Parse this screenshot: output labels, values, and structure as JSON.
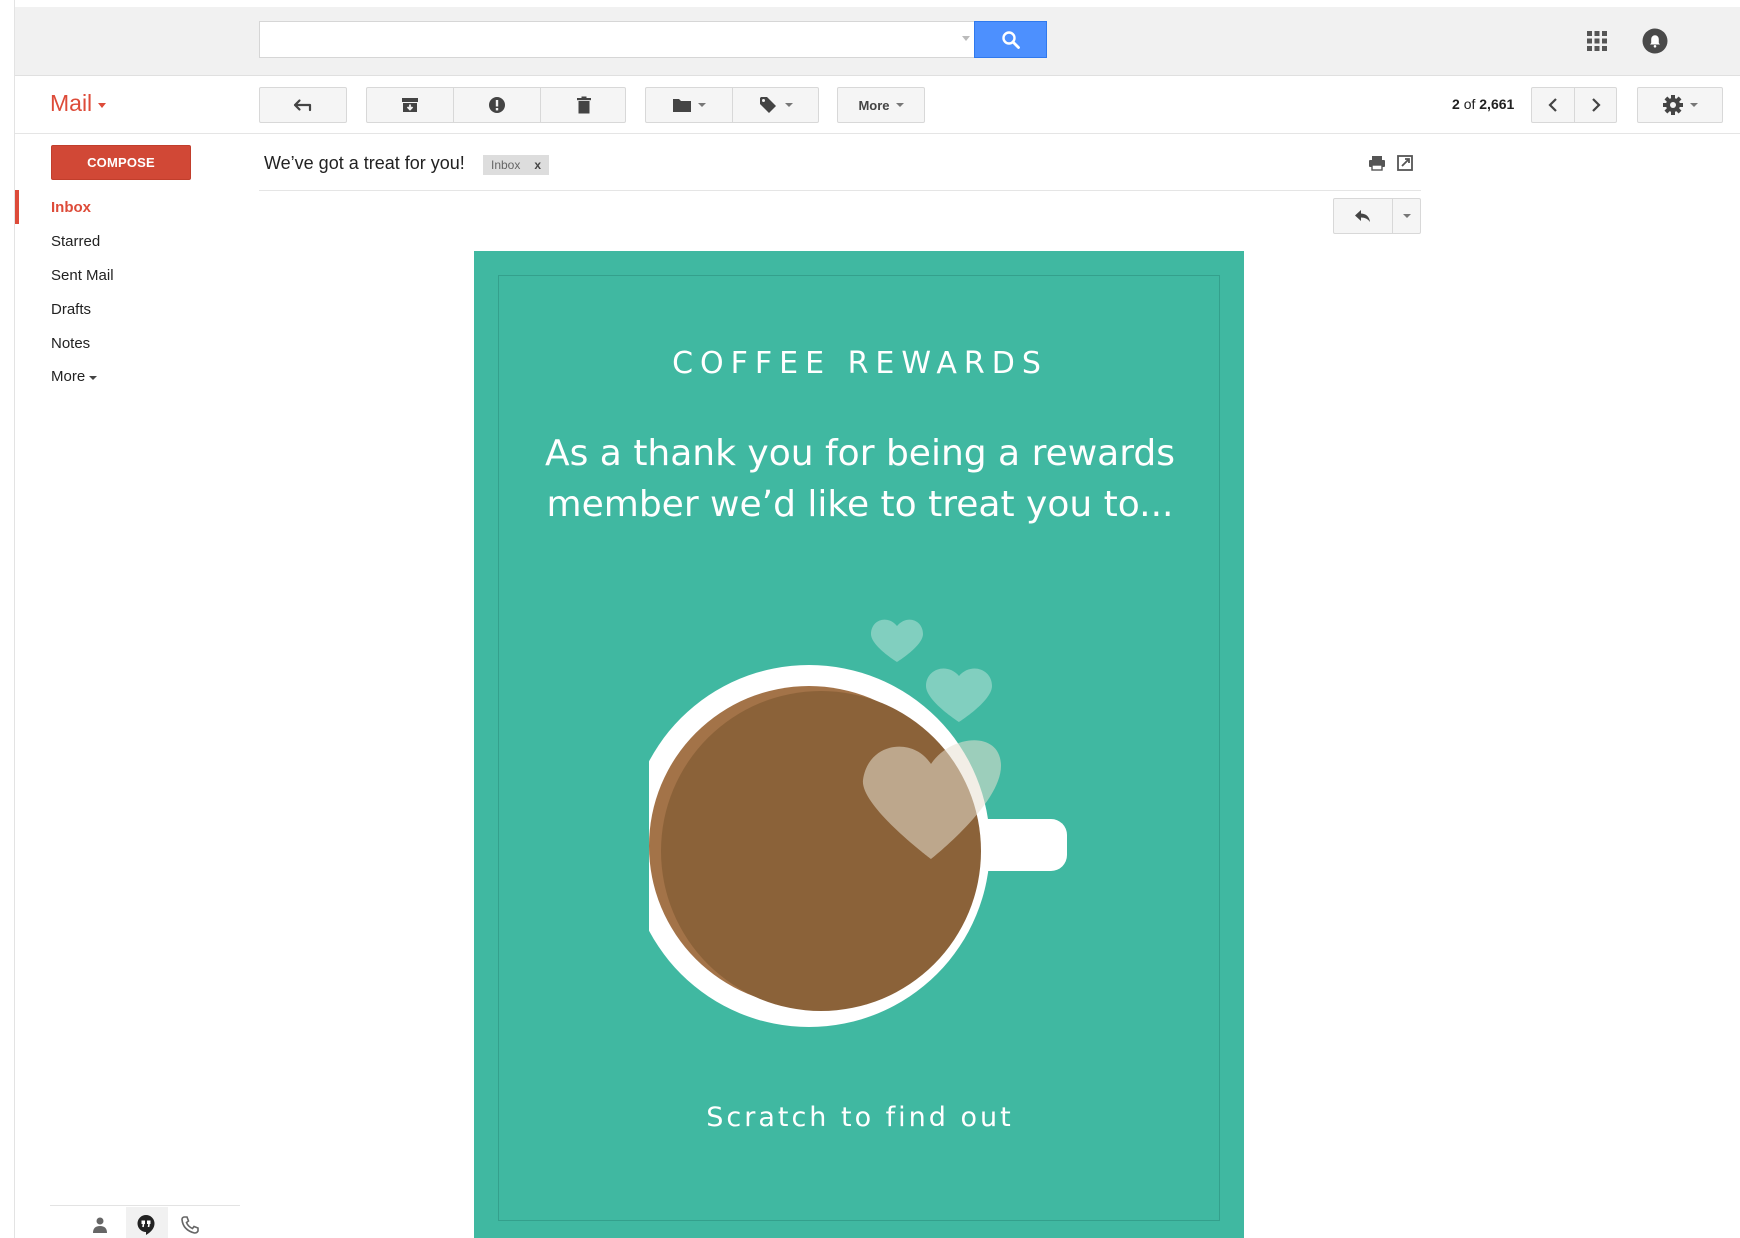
{
  "search": {
    "placeholder": "",
    "value": ""
  },
  "brand": {
    "label": "Mail"
  },
  "toolbar": {
    "more_label": "More"
  },
  "pager": {
    "current": "2",
    "of": "of",
    "total": "2,661"
  },
  "compose": {
    "label": "COMPOSE"
  },
  "sidebar": {
    "items": [
      {
        "label": "Inbox",
        "active": true
      },
      {
        "label": "Starred"
      },
      {
        "label": "Sent Mail"
      },
      {
        "label": "Drafts"
      },
      {
        "label": "Notes"
      },
      {
        "label": "More"
      }
    ]
  },
  "email": {
    "subject": "We’ve got a treat for you!",
    "label": "Inbox",
    "label_remove": "x",
    "body": {
      "title": "COFFEE REWARDS",
      "message": "As a thank you for being a rewards member we’d like to treat you to...",
      "cta": "Scratch to find out"
    }
  },
  "colors": {
    "brand_red": "#dd4b39",
    "compose_red": "#d14836",
    "search_blue": "#4d90fe",
    "card_teal": "#40b8a1",
    "coffee_brown": "#8b6239",
    "coffee_rim": "#a37348"
  },
  "icons": {
    "search": "search-icon",
    "apps": "apps-grid-icon",
    "notifications": "notifications-icon",
    "back": "back-arrow-icon",
    "archive": "archive-icon",
    "spam": "report-spam-icon",
    "delete": "trash-icon",
    "move": "folder-icon",
    "labels": "label-tag-icon",
    "prev": "chevron-left-icon",
    "next": "chevron-right-icon",
    "settings": "gear-icon",
    "print": "print-icon",
    "newwindow": "new-window-icon",
    "reply": "reply-icon",
    "contacts": "person-icon",
    "hangouts": "hangouts-icon",
    "phone": "phone-icon"
  }
}
